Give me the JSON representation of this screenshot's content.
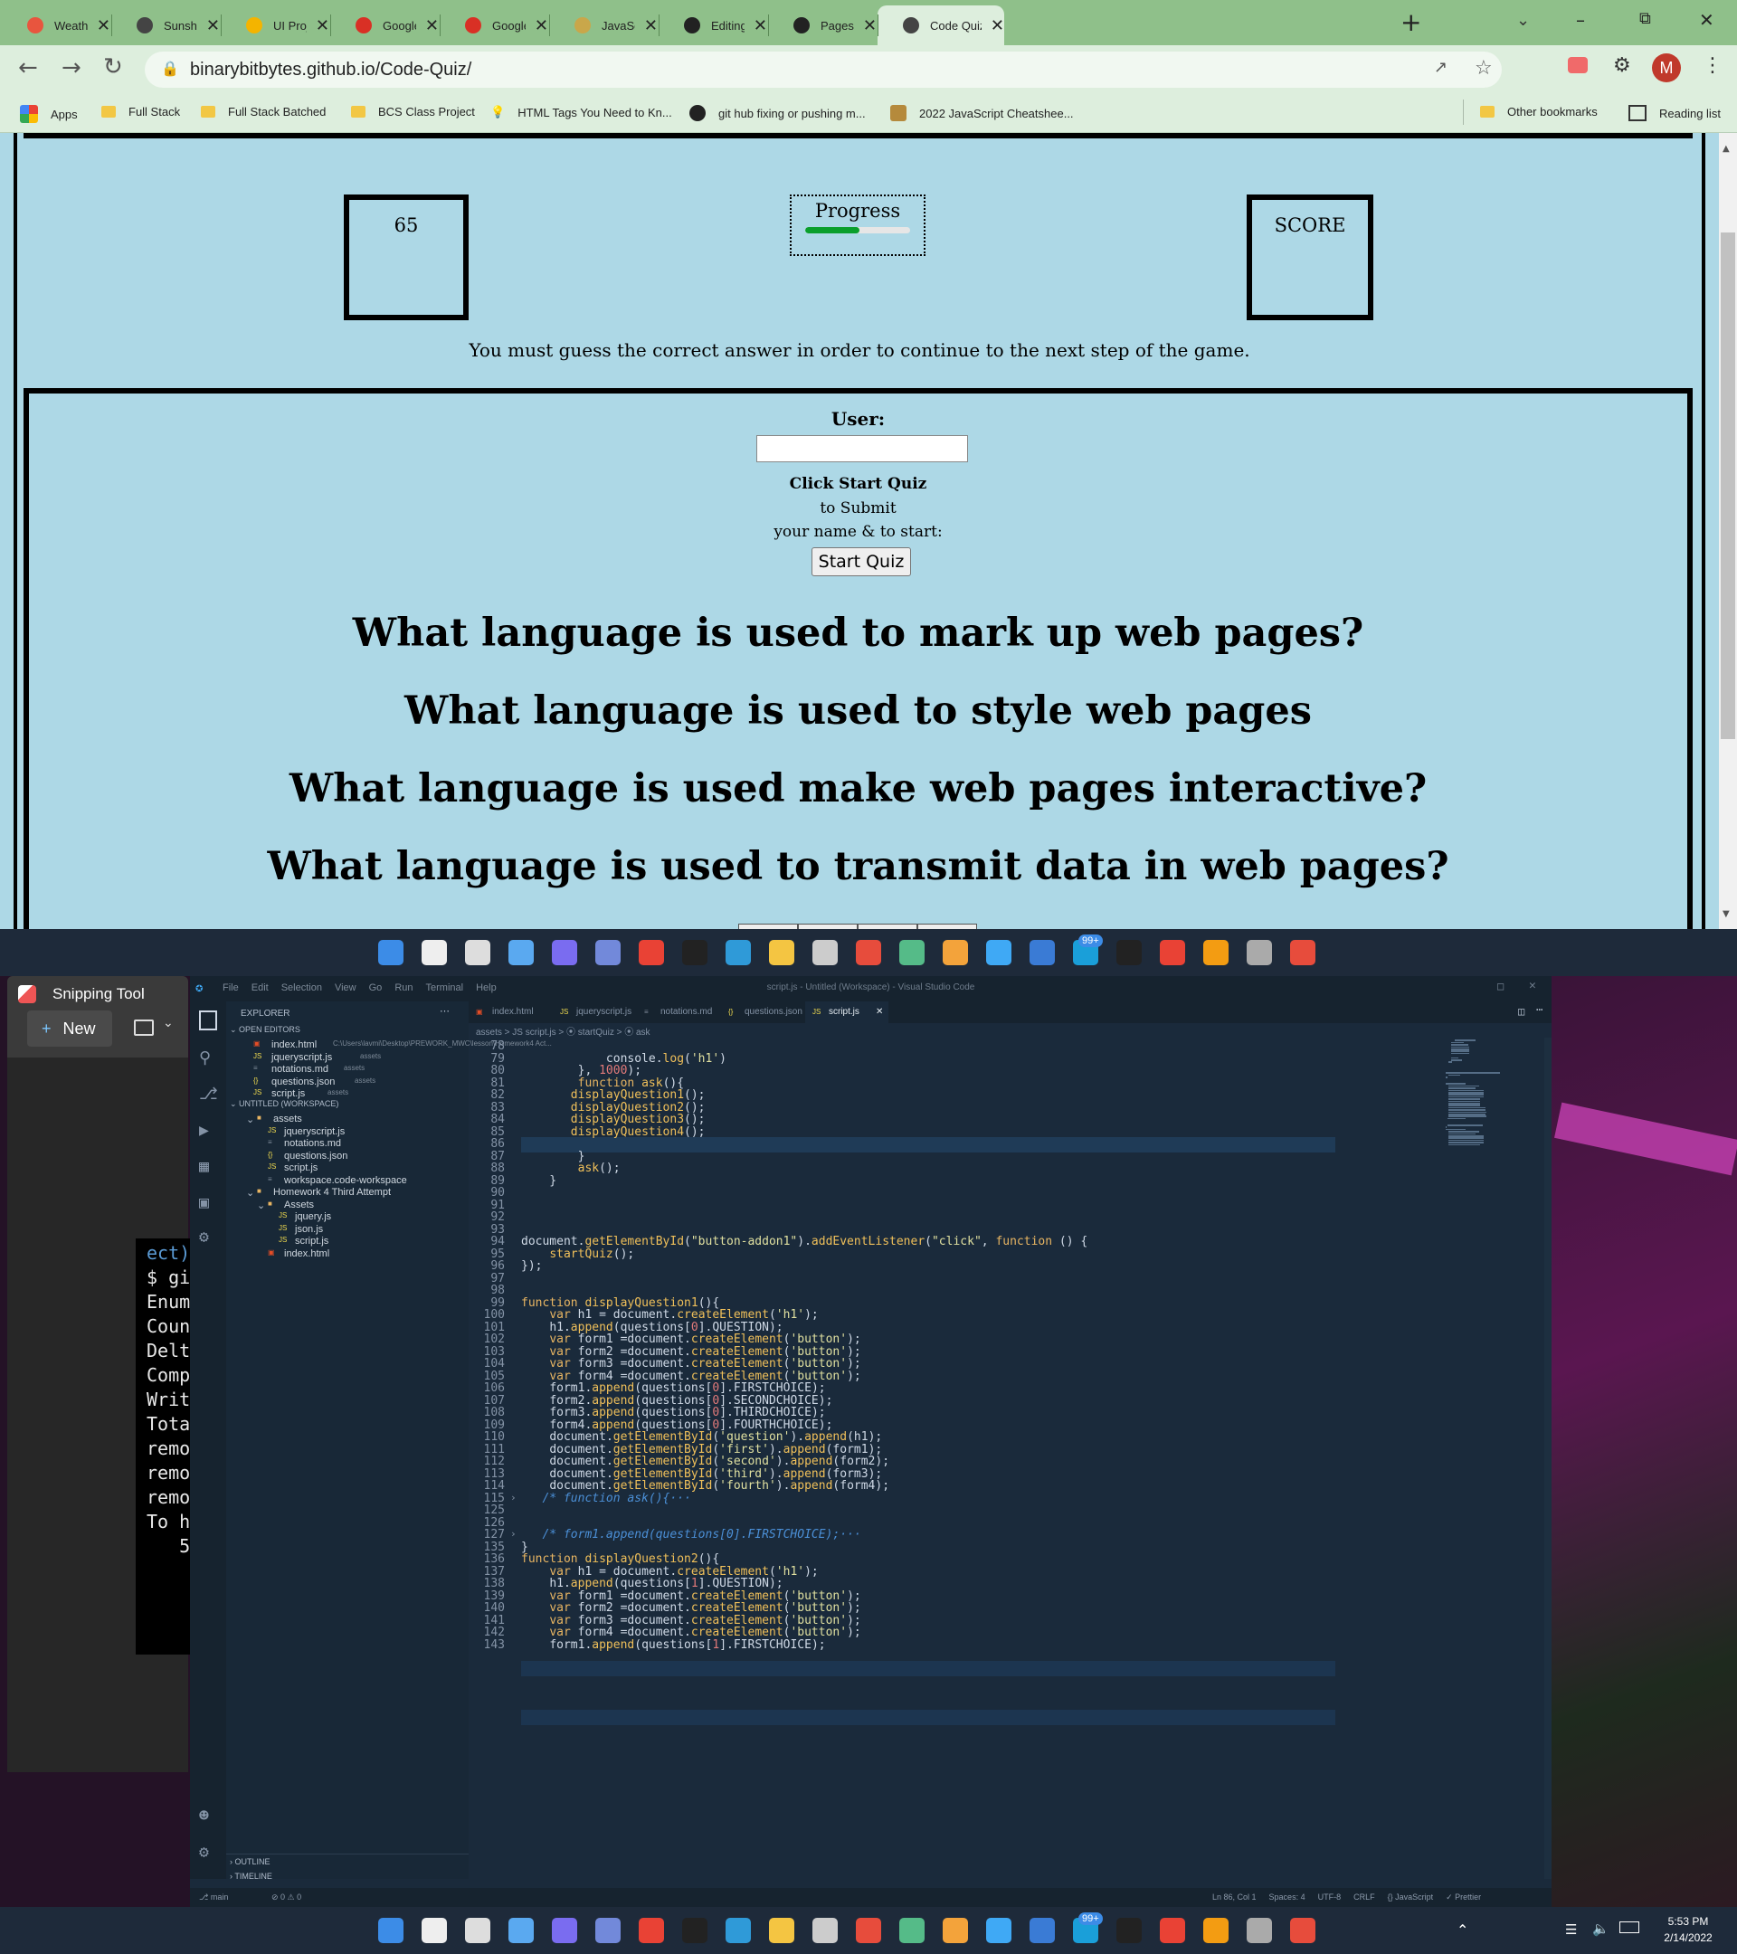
{
  "browser": {
    "tabs": [
      {
        "title": "Weather Con",
        "color": "#e8553e"
      },
      {
        "title": "Sunshine",
        "color": "#444444"
      },
      {
        "title": "UI Project - G",
        "color": "#f4b400"
      },
      {
        "title": "Google Docs",
        "color": "#d93025"
      },
      {
        "title": "Google Docs",
        "color": "#d93025"
      },
      {
        "title": "JavaScript, a",
        "color": "#c9a74a"
      },
      {
        "title": "Editing Code",
        "color": "#222222"
      },
      {
        "title": "Pages",
        "color": "#222222"
      },
      {
        "title": "Code Quiz",
        "color": "#444444"
      }
    ],
    "url": "binarybitbytes.github.io/Code-Quiz/",
    "profile_initial": "M",
    "bookmarks": [
      "Apps",
      "Full Stack",
      "Full Stack Batched",
      "BCS Class Project",
      "HTML Tags You Need to Kn...",
      "git hub fixing or pushing m...",
      "2022 JavaScript Cheatshee..."
    ],
    "other_bookmarks": "Other bookmarks",
    "reading_list": "Reading list"
  },
  "quiz": {
    "timer_value": "65",
    "progress_label": "Progress",
    "progress_fraction": 0.52,
    "score_label": "SCORE",
    "instruction": "You must guess the correct answer in order to continue to the next step of the game.",
    "user_label": "User:",
    "click_start": "Click Start Quiz",
    "to_submit": "to Submit",
    "name_start": "your name & to start:",
    "start_button": "Start Quiz",
    "questions": [
      "What language is used to mark up web pages?",
      "What language is used to style web pages",
      "What language is used make web pages interactive?",
      "What language is used to transmit data in web pages?"
    ]
  },
  "snipping": {
    "title": "Snipping Tool",
    "new_label": "New"
  },
  "terminal_lines": [
    "ect)",
    "$ gi",
    "Enum",
    "Coun",
    "Delt",
    "Comp",
    "Writ",
    "Tota",
    "remo",
    "remo",
    "remo",
    "To h",
    "   5"
  ],
  "vscode": {
    "window_title": "script.js - Untitled (Workspace) - Visual Studio Code",
    "menu": [
      "File",
      "Edit",
      "Selection",
      "View",
      "Go",
      "Run",
      "Terminal",
      "Help"
    ],
    "explorer_label": "EXPLORER",
    "open_editors_label": "OPEN EDITORS",
    "open_editors": [
      {
        "name": "index.html",
        "hint": "C:\\Users\\lavmi\\Desktop\\PREWORK_MWC\\lesson\\Homework4 Act..."
      },
      {
        "name": "jqueryscript.js",
        "hint": "assets"
      },
      {
        "name": "notations.md",
        "hint": "assets"
      },
      {
        "name": "questions.json",
        "hint": "assets"
      },
      {
        "name": "script.js",
        "hint": "assets"
      }
    ],
    "workspace_label": "UNTITLED (WORKSPACE)",
    "tree": [
      {
        "name": "assets",
        "depth": 1
      },
      {
        "name": "jqueryscript.js",
        "depth": 2
      },
      {
        "name": "notations.md",
        "depth": 2
      },
      {
        "name": "questions.json",
        "depth": 2
      },
      {
        "name": "script.js",
        "depth": 2
      },
      {
        "name": "workspace.code-workspace",
        "depth": 2
      },
      {
        "name": "Homework 4 Third Attempt",
        "depth": 1
      },
      {
        "name": "Assets",
        "depth": 2
      },
      {
        "name": "jquery.js",
        "depth": 3
      },
      {
        "name": "json.js",
        "depth": 3
      },
      {
        "name": "script.js",
        "depth": 3
      },
      {
        "name": "index.html",
        "depth": 2
      }
    ],
    "outline_label": "OUTLINE",
    "timeline_label": "TIMELINE",
    "editor_tabs": [
      "index.html",
      "jqueryscript.js",
      "notations.md",
      "questions.json",
      "script.js"
    ],
    "breadcrumb": "assets > JS script.js > ⦿ startQuiz > ⦿ ask",
    "code_lines": [
      {
        "n": "78",
        "t": ""
      },
      {
        "n": "79",
        "t": "            console.log('h1')"
      },
      {
        "n": "80",
        "t": "        }, 1000);"
      },
      {
        "n": "81",
        "t": "        function ask(){"
      },
      {
        "n": "82",
        "t": "       displayQuestion1();"
      },
      {
        "n": "83",
        "t": "       displayQuestion2();"
      },
      {
        "n": "84",
        "t": "       displayQuestion3();"
      },
      {
        "n": "85",
        "t": "       displayQuestion4();"
      },
      {
        "n": "86",
        "t": ""
      },
      {
        "n": "87",
        "t": "        }"
      },
      {
        "n": "88",
        "t": "        ask();"
      },
      {
        "n": "89",
        "t": "    }"
      },
      {
        "n": "90",
        "t": ""
      },
      {
        "n": "91",
        "t": ""
      },
      {
        "n": "92",
        "t": ""
      },
      {
        "n": "93",
        "t": ""
      },
      {
        "n": "94",
        "t": "document.getElementById(\"button-addon1\").addEventListener(\"click\", function () {"
      },
      {
        "n": "95",
        "t": "    startQuiz();"
      },
      {
        "n": "96",
        "t": "});"
      },
      {
        "n": "97",
        "t": ""
      },
      {
        "n": "98",
        "t": ""
      },
      {
        "n": "99",
        "t": "function displayQuestion1(){"
      },
      {
        "n": "100",
        "t": "    var h1 = document.createElement('h1');"
      },
      {
        "n": "101",
        "t": "    h1.append(questions[0].QUESTION);"
      },
      {
        "n": "102",
        "t": "    var form1 =document.createElement('button');"
      },
      {
        "n": "103",
        "t": "    var form2 =document.createElement('button');"
      },
      {
        "n": "104",
        "t": "    var form3 =document.createElement('button');"
      },
      {
        "n": "105",
        "t": "    var form4 =document.createElement('button');"
      },
      {
        "n": "106",
        "t": "    form1.append(questions[0].FIRSTCHOICE);"
      },
      {
        "n": "107",
        "t": "    form2.append(questions[0].SECONDCHOICE);"
      },
      {
        "n": "108",
        "t": "    form3.append(questions[0].THIRDCHOICE);"
      },
      {
        "n": "109",
        "t": "    form4.append(questions[0].FOURTHCHOICE);"
      },
      {
        "n": "110",
        "t": "    document.getElementById('question').append(h1);"
      },
      {
        "n": "111",
        "t": "    document.getElementById('first').append(form1);"
      },
      {
        "n": "112",
        "t": "    document.getElementById('second').append(form2);"
      },
      {
        "n": "113",
        "t": "    document.getElementById('third').append(form3);"
      },
      {
        "n": "114",
        "t": "    document.getElementById('fourth').append(form4);"
      },
      {
        "n": "115",
        "t": "   /* function ask(){···"
      },
      {
        "n": "125",
        "t": ""
      },
      {
        "n": "126",
        "t": ""
      },
      {
        "n": "127",
        "t": "   /* form1.append(questions[0].FIRSTCHOICE);···"
      },
      {
        "n": "135",
        "t": "}"
      },
      {
        "n": "136",
        "t": "function displayQuestion2(){"
      },
      {
        "n": "137",
        "t": "    var h1 = document.createElement('h1');"
      },
      {
        "n": "138",
        "t": "    h1.append(questions[1].QUESTION);"
      },
      {
        "n": "139",
        "t": "    var form1 =document.createElement('button');"
      },
      {
        "n": "140",
        "t": "    var form2 =document.createElement('button');"
      },
      {
        "n": "141",
        "t": "    var form3 =document.createElement('button');"
      },
      {
        "n": "142",
        "t": "    var form4 =document.createElement('button');"
      },
      {
        "n": "143",
        "t": "    form1.append(questions[1].FIRSTCHOICE);"
      }
    ],
    "status_left": "main",
    "status_right": [
      "Ln 86, Col 1",
      "Spaces: 4",
      "UTF-8",
      "CRLF",
      "{} JavaScript",
      "✓ Prettier"
    ]
  },
  "taskbar": {
    "time": "5:53 PM",
    "date": "2/14/2022",
    "badge": "99+"
  }
}
